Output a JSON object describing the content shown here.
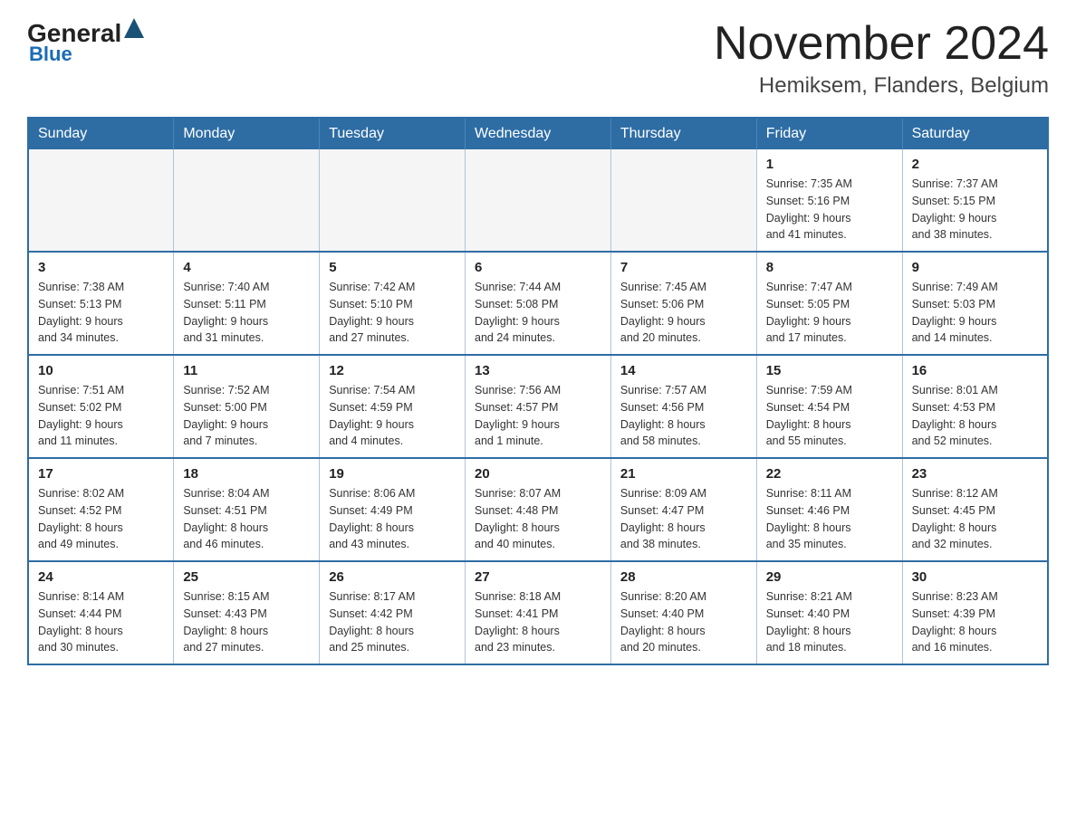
{
  "header": {
    "logo": {
      "general": "General",
      "blue": "Blue"
    },
    "title": "November 2024",
    "location": "Hemiksem, Flanders, Belgium"
  },
  "weekdays": [
    "Sunday",
    "Monday",
    "Tuesday",
    "Wednesday",
    "Thursday",
    "Friday",
    "Saturday"
  ],
  "weeks": [
    [
      {
        "day": "",
        "info": ""
      },
      {
        "day": "",
        "info": ""
      },
      {
        "day": "",
        "info": ""
      },
      {
        "day": "",
        "info": ""
      },
      {
        "day": "",
        "info": ""
      },
      {
        "day": "1",
        "info": "Sunrise: 7:35 AM\nSunset: 5:16 PM\nDaylight: 9 hours\nand 41 minutes."
      },
      {
        "day": "2",
        "info": "Sunrise: 7:37 AM\nSunset: 5:15 PM\nDaylight: 9 hours\nand 38 minutes."
      }
    ],
    [
      {
        "day": "3",
        "info": "Sunrise: 7:38 AM\nSunset: 5:13 PM\nDaylight: 9 hours\nand 34 minutes."
      },
      {
        "day": "4",
        "info": "Sunrise: 7:40 AM\nSunset: 5:11 PM\nDaylight: 9 hours\nand 31 minutes."
      },
      {
        "day": "5",
        "info": "Sunrise: 7:42 AM\nSunset: 5:10 PM\nDaylight: 9 hours\nand 27 minutes."
      },
      {
        "day": "6",
        "info": "Sunrise: 7:44 AM\nSunset: 5:08 PM\nDaylight: 9 hours\nand 24 minutes."
      },
      {
        "day": "7",
        "info": "Sunrise: 7:45 AM\nSunset: 5:06 PM\nDaylight: 9 hours\nand 20 minutes."
      },
      {
        "day": "8",
        "info": "Sunrise: 7:47 AM\nSunset: 5:05 PM\nDaylight: 9 hours\nand 17 minutes."
      },
      {
        "day": "9",
        "info": "Sunrise: 7:49 AM\nSunset: 5:03 PM\nDaylight: 9 hours\nand 14 minutes."
      }
    ],
    [
      {
        "day": "10",
        "info": "Sunrise: 7:51 AM\nSunset: 5:02 PM\nDaylight: 9 hours\nand 11 minutes."
      },
      {
        "day": "11",
        "info": "Sunrise: 7:52 AM\nSunset: 5:00 PM\nDaylight: 9 hours\nand 7 minutes."
      },
      {
        "day": "12",
        "info": "Sunrise: 7:54 AM\nSunset: 4:59 PM\nDaylight: 9 hours\nand 4 minutes."
      },
      {
        "day": "13",
        "info": "Sunrise: 7:56 AM\nSunset: 4:57 PM\nDaylight: 9 hours\nand 1 minute."
      },
      {
        "day": "14",
        "info": "Sunrise: 7:57 AM\nSunset: 4:56 PM\nDaylight: 8 hours\nand 58 minutes."
      },
      {
        "day": "15",
        "info": "Sunrise: 7:59 AM\nSunset: 4:54 PM\nDaylight: 8 hours\nand 55 minutes."
      },
      {
        "day": "16",
        "info": "Sunrise: 8:01 AM\nSunset: 4:53 PM\nDaylight: 8 hours\nand 52 minutes."
      }
    ],
    [
      {
        "day": "17",
        "info": "Sunrise: 8:02 AM\nSunset: 4:52 PM\nDaylight: 8 hours\nand 49 minutes."
      },
      {
        "day": "18",
        "info": "Sunrise: 8:04 AM\nSunset: 4:51 PM\nDaylight: 8 hours\nand 46 minutes."
      },
      {
        "day": "19",
        "info": "Sunrise: 8:06 AM\nSunset: 4:49 PM\nDaylight: 8 hours\nand 43 minutes."
      },
      {
        "day": "20",
        "info": "Sunrise: 8:07 AM\nSunset: 4:48 PM\nDaylight: 8 hours\nand 40 minutes."
      },
      {
        "day": "21",
        "info": "Sunrise: 8:09 AM\nSunset: 4:47 PM\nDaylight: 8 hours\nand 38 minutes."
      },
      {
        "day": "22",
        "info": "Sunrise: 8:11 AM\nSunset: 4:46 PM\nDaylight: 8 hours\nand 35 minutes."
      },
      {
        "day": "23",
        "info": "Sunrise: 8:12 AM\nSunset: 4:45 PM\nDaylight: 8 hours\nand 32 minutes."
      }
    ],
    [
      {
        "day": "24",
        "info": "Sunrise: 8:14 AM\nSunset: 4:44 PM\nDaylight: 8 hours\nand 30 minutes."
      },
      {
        "day": "25",
        "info": "Sunrise: 8:15 AM\nSunset: 4:43 PM\nDaylight: 8 hours\nand 27 minutes."
      },
      {
        "day": "26",
        "info": "Sunrise: 8:17 AM\nSunset: 4:42 PM\nDaylight: 8 hours\nand 25 minutes."
      },
      {
        "day": "27",
        "info": "Sunrise: 8:18 AM\nSunset: 4:41 PM\nDaylight: 8 hours\nand 23 minutes."
      },
      {
        "day": "28",
        "info": "Sunrise: 8:20 AM\nSunset: 4:40 PM\nDaylight: 8 hours\nand 20 minutes."
      },
      {
        "day": "29",
        "info": "Sunrise: 8:21 AM\nSunset: 4:40 PM\nDaylight: 8 hours\nand 18 minutes."
      },
      {
        "day": "30",
        "info": "Sunrise: 8:23 AM\nSunset: 4:39 PM\nDaylight: 8 hours\nand 16 minutes."
      }
    ]
  ]
}
